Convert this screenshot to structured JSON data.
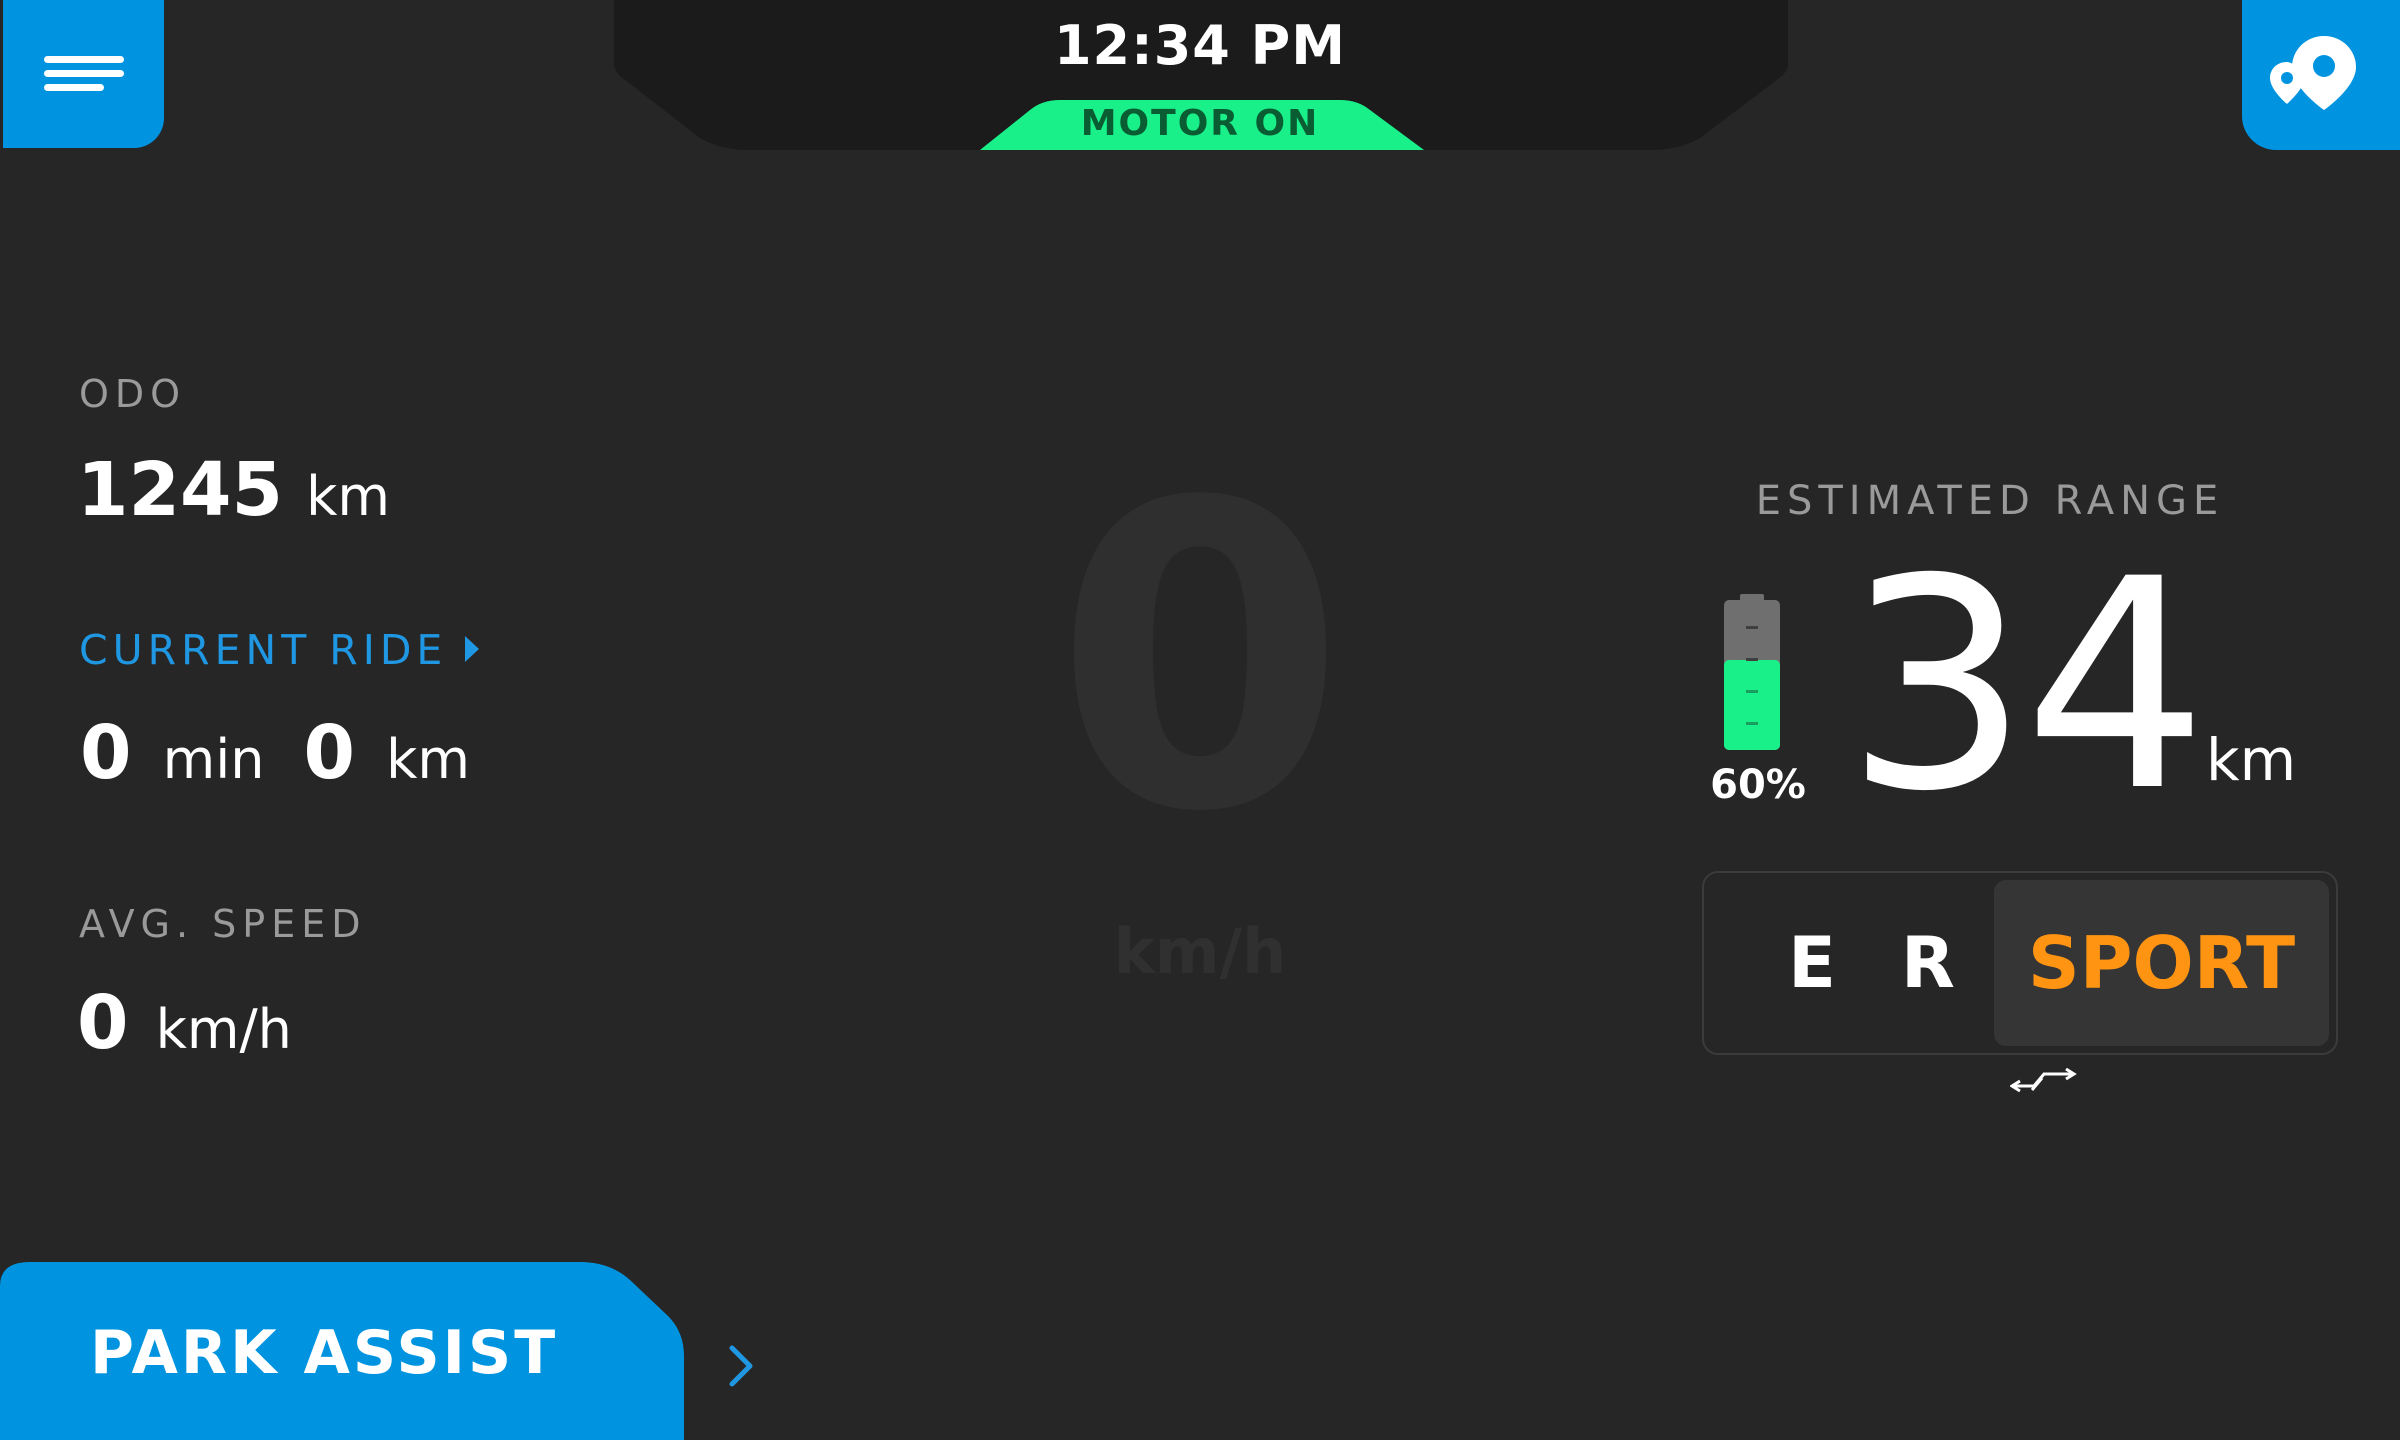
{
  "header": {
    "clock": "12:34 PM",
    "motor_status": "MOTOR ON"
  },
  "stats": {
    "odo_label": "ODO",
    "odo_value": "1245",
    "odo_unit": "km",
    "current_ride_label": "CURRENT RIDE",
    "ride_minutes": "0",
    "ride_minutes_unit": "min",
    "ride_distance": "0",
    "ride_distance_unit": "km",
    "avg_speed_label": "AVG. SPEED",
    "avg_speed_value": "0",
    "avg_speed_unit": "km/h"
  },
  "speed": {
    "value": "0",
    "unit": "km/h"
  },
  "range": {
    "label": "ESTIMATED RANGE",
    "value": "34",
    "unit": "km",
    "battery_percent_text": "60%",
    "battery_fraction": 0.6
  },
  "modes": {
    "items": [
      "E",
      "R",
      "SPORT"
    ],
    "selected": "SPORT"
  },
  "park_assist": {
    "label": "PARK ASSIST"
  },
  "colors": {
    "background": "#262626",
    "accent_blue": "#0094e0",
    "motor_on_green": "#19f08a",
    "battery_green": "#19f08a",
    "sport_orange": "#ff9412",
    "label_grey": "#9a9a9a"
  },
  "icons": {
    "menu": "hamburger-menu-icon",
    "map": "map-location-pin-icon",
    "battery": "battery-icon",
    "mode_switch": "mode-switch-arrows-icon",
    "park_chevron": "chevron-right-icon"
  }
}
